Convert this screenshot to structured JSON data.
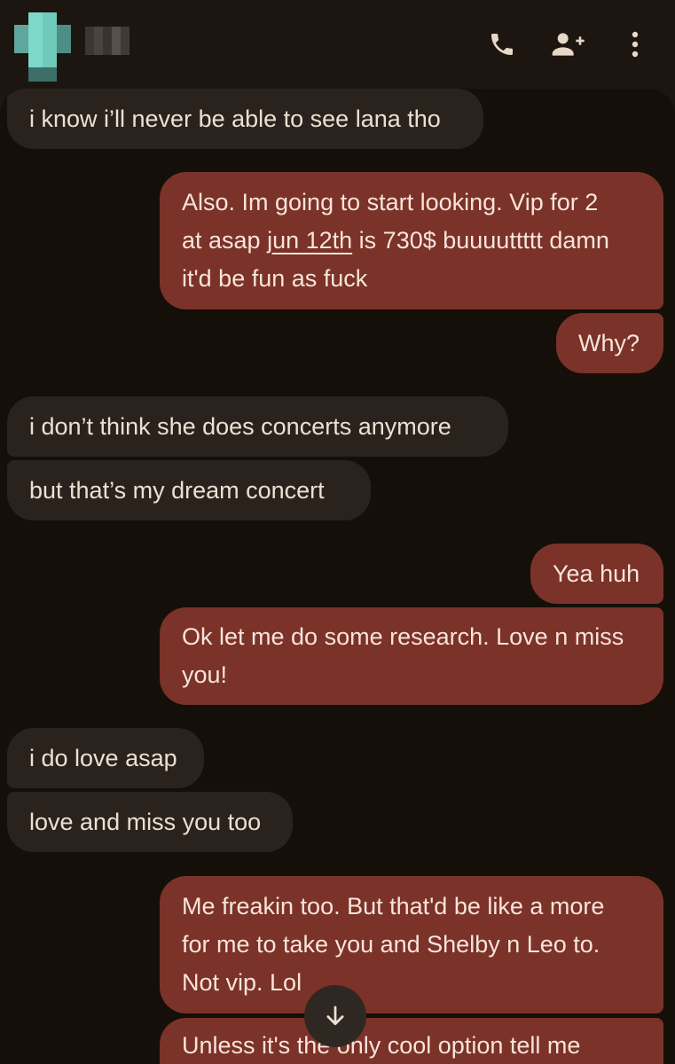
{
  "header": {
    "contact_name": "",
    "icons": [
      "phone-icon",
      "add-person-icon",
      "more-vert-icon"
    ],
    "icon_color": "#e8d8c8"
  },
  "colors": {
    "background": "#150f09",
    "incoming_bubble": "#2a231d",
    "outgoing_bubble": "#7b3228",
    "incoming_text": "#ede0d2",
    "outgoing_text": "#f7e4dc"
  },
  "messages": [
    {
      "from": "them",
      "text": "i know i’ll never be able to see lana tho"
    },
    {
      "from": "me",
      "parts": [
        "Also. Im going to start looking. Vip for 2\nat asap ",
        "jun 12th",
        " is 730$ buuuuttttt damn\nit'd be fun as fuck"
      ]
    },
    {
      "from": "me",
      "text": "Why?"
    },
    {
      "from": "them",
      "text": "i don’t think she does concerts anymore"
    },
    {
      "from": "them",
      "text": "but that’s my dream concert"
    },
    {
      "from": "me",
      "text": "Yea huh"
    },
    {
      "from": "me",
      "text": "Ok let me do some research. Love n miss\nyou!"
    },
    {
      "from": "them",
      "text": "i do love asap"
    },
    {
      "from": "them",
      "text": "love and miss you too"
    },
    {
      "from": "me",
      "text": "Me freakin too. But that'd be like a more\nfor me to take you and Shelby n Leo to.\nNot vip. Lol"
    },
    {
      "from": "me",
      "text": "Unless it's the only cool option tell me"
    }
  ],
  "scroll_button": {
    "icon": "arrow-down-icon"
  }
}
